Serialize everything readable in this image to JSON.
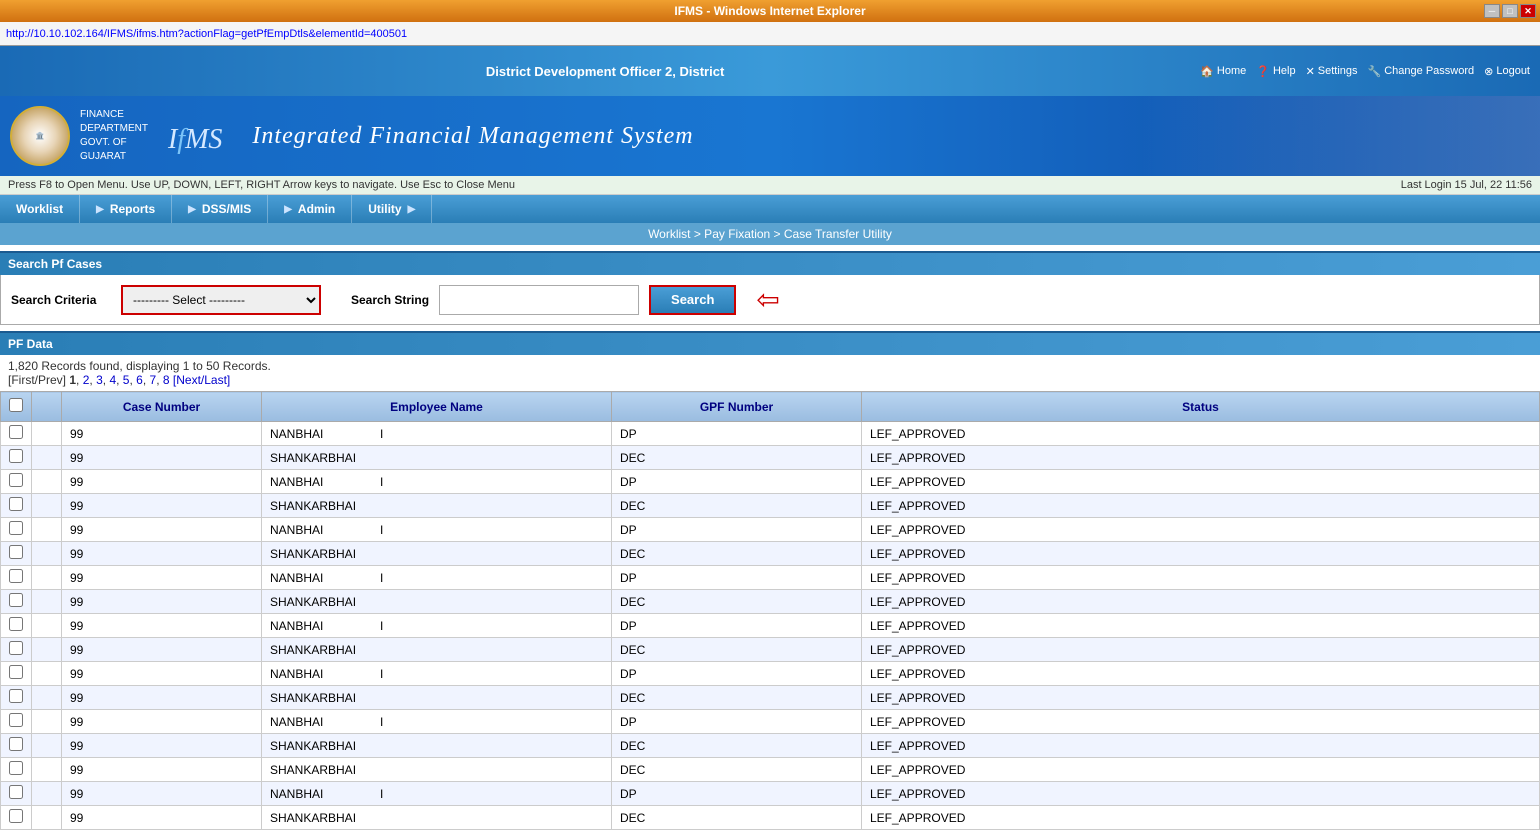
{
  "window": {
    "title": "IFMS - Windows Internet Explorer",
    "address": "http://10.10.102.164/IFMS/ifms.htm?actionFlag=getPfEmpDtls&elementId=400501"
  },
  "banner": {
    "district_text": "District Development Officer 2, District",
    "links": [
      "Home",
      "Help",
      "Settings",
      "Change Password",
      "Logout"
    ]
  },
  "header": {
    "finance_lines": [
      "FINANCE",
      "DEPARTMENT",
      "GOVT. OF",
      "GUJARAT"
    ],
    "ifms_label": "IfMS",
    "system_name": "Integrated Financial Management System"
  },
  "nav_hint": "Press F8 to Open Menu. Use UP, DOWN, LEFT, RIGHT Arrow keys to navigate. Use Esc to Close Menu",
  "last_login": "Last Login 15 Jul, 22 11:56",
  "nav_items": [
    {
      "label": "Worklist",
      "has_arrow": false
    },
    {
      "label": "Reports",
      "has_arrow": true
    },
    {
      "label": "DSS/MIS",
      "has_arrow": true
    },
    {
      "label": "Admin",
      "has_arrow": true
    },
    {
      "label": "Utility",
      "has_arrow": true
    }
  ],
  "breadcrumb": "Worklist > Pay Fixation > Case Transfer Utility",
  "search_section": {
    "title": "Search Pf Cases",
    "criteria_label": "Search Criteria",
    "select_placeholder": "--------- Select ---------",
    "string_label": "Search String",
    "search_button": "Search"
  },
  "pf_section": {
    "title": "PF Data",
    "records_text": "1,820 Records found, displaying 1 to 50 Records.",
    "pagination": {
      "prefix": "[First/Prev]",
      "pages": [
        "1",
        "2",
        "3",
        "4",
        "5",
        "6",
        "7",
        "8"
      ],
      "suffix": "[Next/Last]",
      "current": "1"
    }
  },
  "table": {
    "headers": [
      "",
      "",
      "Case Number",
      "Employee Name",
      "GPF Number",
      "Status"
    ],
    "rows": [
      {
        "case": "99",
        "emp": "NANBHAI",
        "suffix": "I",
        "gpf": "DP",
        "status": "LEF_APPROVED"
      },
      {
        "case": "99",
        "emp": "SHANKARBHAI",
        "suffix": "",
        "gpf": "DEC",
        "status": "LEF_APPROVED"
      },
      {
        "case": "99",
        "emp": "NANBHAI",
        "suffix": "I",
        "gpf": "DP",
        "status": "LEF_APPROVED"
      },
      {
        "case": "99",
        "emp": "SHANKARBHAI",
        "suffix": "",
        "gpf": "DEC",
        "status": "LEF_APPROVED"
      },
      {
        "case": "99",
        "emp": "NANBHAI",
        "suffix": "I",
        "gpf": "DP",
        "status": "LEF_APPROVED"
      },
      {
        "case": "99",
        "emp": "SHANKARBHAI",
        "suffix": "",
        "gpf": "DEC",
        "status": "LEF_APPROVED"
      },
      {
        "case": "99",
        "emp": "NANBHAI",
        "suffix": "I",
        "gpf": "DP",
        "status": "LEF_APPROVED"
      },
      {
        "case": "99",
        "emp": "SHANKARBHAI",
        "suffix": "",
        "gpf": "DEC",
        "status": "LEF_APPROVED"
      },
      {
        "case": "99",
        "emp": "NANBHAI",
        "suffix": "I",
        "gpf": "DP",
        "status": "LEF_APPROVED"
      },
      {
        "case": "99",
        "emp": "SHANKARBHAI",
        "suffix": "",
        "gpf": "DEC",
        "status": "LEF_APPROVED"
      },
      {
        "case": "99",
        "emp": "NANBHAI",
        "suffix": "I",
        "gpf": "DP",
        "status": "LEF_APPROVED"
      },
      {
        "case": "99",
        "emp": "SHANKARBHAI",
        "suffix": "",
        "gpf": "DEC",
        "status": "LEF_APPROVED"
      },
      {
        "case": "99",
        "emp": "NANBHAI",
        "suffix": "I",
        "gpf": "DP",
        "status": "LEF_APPROVED"
      },
      {
        "case": "99",
        "emp": "SHANKARBHAI",
        "suffix": "",
        "gpf": "DEC",
        "status": "LEF_APPROVED"
      },
      {
        "case": "99",
        "emp": "SHANKARBHAI",
        "suffix": "",
        "gpf": "DEC",
        "status": "LEF_APPROVED"
      },
      {
        "case": "99",
        "emp": "NANBHAI",
        "suffix": "I",
        "gpf": "DP",
        "status": "LEF_APPROVED"
      },
      {
        "case": "99",
        "emp": "SHANKARBHAI",
        "suffix": "",
        "gpf": "DEC",
        "status": "LEF_APPROVED"
      }
    ]
  }
}
